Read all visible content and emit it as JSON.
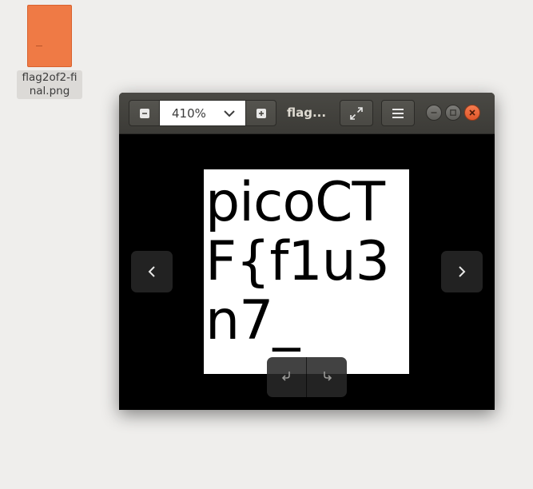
{
  "desktop": {
    "file_icon": {
      "label": "flag2of2-final.png",
      "color": "#ef7a45"
    }
  },
  "window": {
    "title": "flag...",
    "zoom": {
      "value": "410%",
      "zoom_out_icon": "minus-icon",
      "zoom_in_icon": "plus-icon",
      "dropdown_icon": "chevron-down-icon"
    },
    "toolbar": {
      "fullscreen_icon": "fullscreen-icon",
      "menu_icon": "hamburger-menu-icon"
    },
    "controls": {
      "minimize_icon": "minimize-icon",
      "maximize_icon": "maximize-icon",
      "close_icon": "close-icon",
      "close_color": "#e95420"
    }
  },
  "image": {
    "lines": [
      "picoCT",
      "F{f1u3",
      "n7_"
    ]
  },
  "navigation": {
    "prev_icon": "chevron-left-icon",
    "next_icon": "chevron-right-icon",
    "rotate_left_icon": "rotate-left-icon",
    "rotate_right_icon": "rotate-right-icon"
  }
}
